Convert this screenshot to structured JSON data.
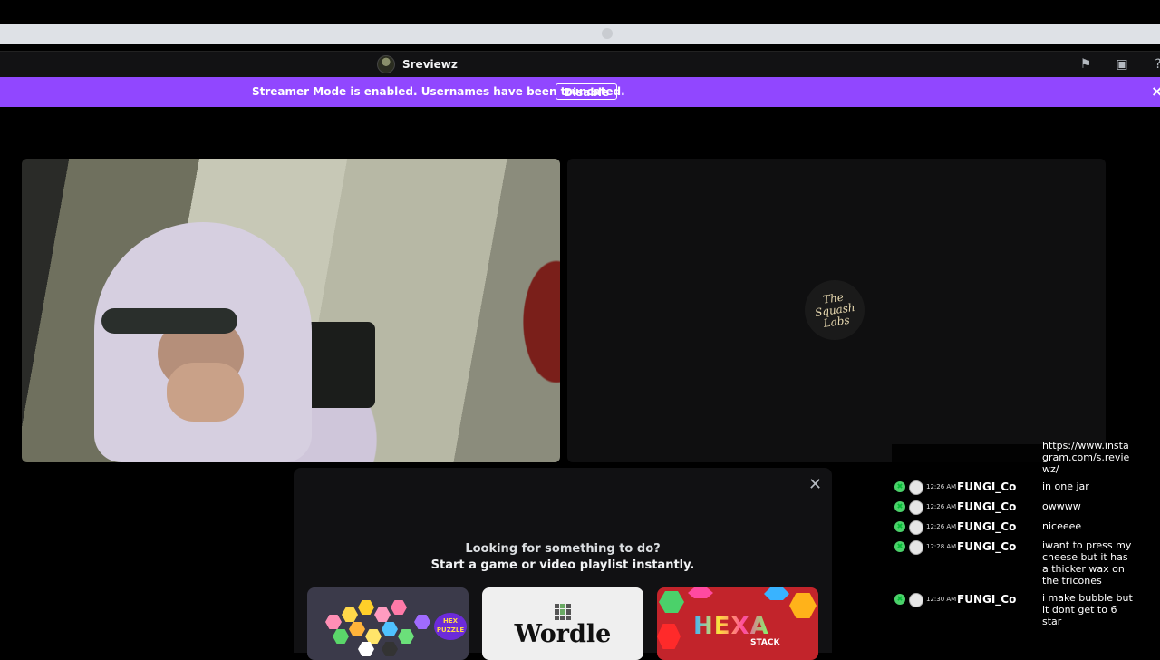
{
  "titlebar": {
    "channel_name": "Sreviewz"
  },
  "banner": {
    "message": "Streamer Mode is enabled. Usernames have been truncated.",
    "disable_label": "Disable"
  },
  "activity": {
    "line1": "Looking for something to do?",
    "line2": "Start a game or video playlist instantly.",
    "games": [
      {
        "title": "Hex Puzzle",
        "badge": "HEX PUZZLE"
      },
      {
        "title": "Wordle"
      },
      {
        "title": "HEXA",
        "subtitle": "STACK"
      }
    ]
  },
  "chat": {
    "partial_message": "https://www.insta gram.com/s.revie wz/",
    "messages": [
      {
        "time": "12:26 AM",
        "user": "FUNGI_Co",
        "text": "in one jar"
      },
      {
        "time": "12:26 AM",
        "user": "FUNGI_Co",
        "text": "owwww"
      },
      {
        "time": "12:26 AM",
        "user": "FUNGI_Co",
        "text": "niceeee"
      },
      {
        "time": "12:28 AM",
        "user": "FUNGI_Co",
        "text": "iwant to press my cheese but it has a thicker wax on the tricones"
      },
      {
        "time": "12:30 AM",
        "user": "FUNGI_Co",
        "text": "i make bubble but it dont get to 6 star"
      }
    ]
  },
  "colors": {
    "banner": "#9147ff",
    "badge": "#4bd16a"
  }
}
